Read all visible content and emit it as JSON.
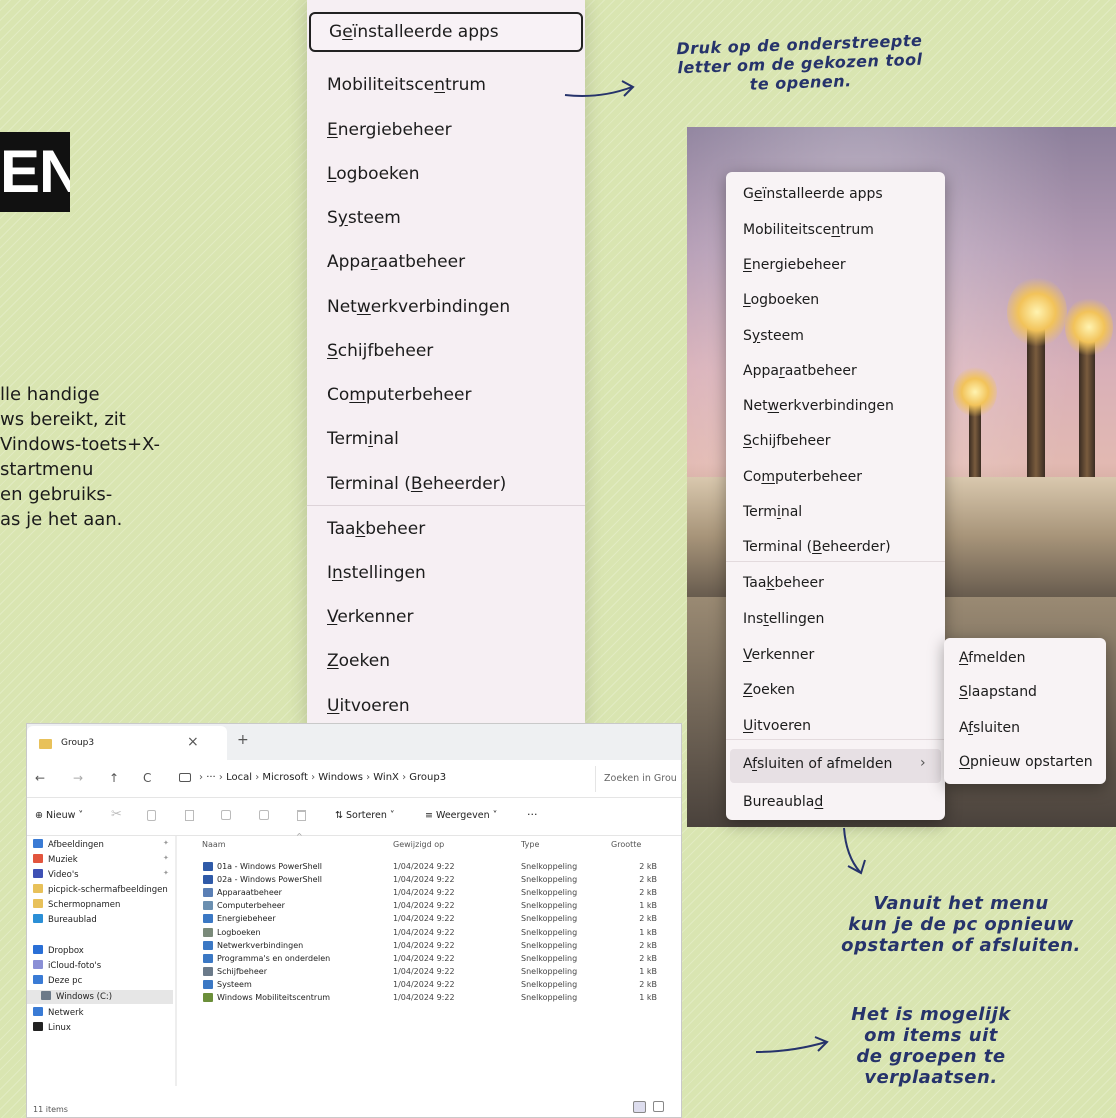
{
  "heading": {
    "letters": "EN"
  },
  "intro": {
    "lines": [
      "lle handige",
      "ws bereikt, zit",
      "Vindows-toets+X-",
      "startmenu",
      "en gebruiks-",
      "as je het aan."
    ]
  },
  "big_menu": {
    "items": [
      {
        "pre": "G",
        "ul": "e",
        "post": "ïnstalleerde apps"
      },
      {
        "pre": "Mobiliteitsce",
        "ul": "n",
        "post": "trum"
      },
      {
        "pre": "",
        "ul": "E",
        "post": "nergiebeheer"
      },
      {
        "pre": "",
        "ul": "L",
        "post": "ogboeken"
      },
      {
        "pre": "S",
        "ul": "y",
        "post": "steem"
      },
      {
        "pre": "Appa",
        "ul": "r",
        "post": "aatbeheer"
      },
      {
        "pre": "Net",
        "ul": "w",
        "post": "erkverbindingen"
      },
      {
        "pre": "",
        "ul": "S",
        "post": "chijfbeheer"
      },
      {
        "pre": "Co",
        "ul": "m",
        "post": "puterbeheer"
      },
      {
        "pre": "Term",
        "ul": "i",
        "post": "nal"
      },
      {
        "pre": "Terminal (",
        "ul": "B",
        "post": "eheerder)"
      },
      {
        "pre": "Taa",
        "ul": "k",
        "post": "beheer"
      },
      {
        "pre": "I",
        "ul": "n",
        "post": "stellingen"
      },
      {
        "pre": "",
        "ul": "V",
        "post": "erkenner"
      },
      {
        "pre": "",
        "ul": "Z",
        "post": "oeken"
      },
      {
        "pre": "",
        "ul": "U",
        "post": "itvoeren"
      }
    ]
  },
  "small_menu": {
    "items": [
      {
        "pre": "G",
        "ul": "e",
        "post": "ïnstalleerde apps"
      },
      {
        "pre": "Mobiliteitsce",
        "ul": "n",
        "post": "trum"
      },
      {
        "pre": "",
        "ul": "E",
        "post": "nergiebeheer"
      },
      {
        "pre": "",
        "ul": "L",
        "post": "ogboeken"
      },
      {
        "pre": "S",
        "ul": "y",
        "post": "steem"
      },
      {
        "pre": "Appa",
        "ul": "r",
        "post": "aatbeheer"
      },
      {
        "pre": "Net",
        "ul": "w",
        "post": "erkverbindingen"
      },
      {
        "pre": "",
        "ul": "S",
        "post": "chijfbeheer"
      },
      {
        "pre": "Co",
        "ul": "m",
        "post": "puterbeheer"
      },
      {
        "pre": "Term",
        "ul": "i",
        "post": "nal"
      },
      {
        "pre": "Terminal (",
        "ul": "B",
        "post": "eheerder)"
      },
      {
        "pre": "Taa",
        "ul": "k",
        "post": "beheer"
      },
      {
        "pre": "Ins",
        "ul": "t",
        "post": "ellingen"
      },
      {
        "pre": "",
        "ul": "V",
        "post": "erkenner"
      },
      {
        "pre": "",
        "ul": "Z",
        "post": "oeken"
      },
      {
        "pre": "",
        "ul": "U",
        "post": "itvoeren"
      },
      {
        "pre": "A",
        "ul": "f",
        "post": "sluiten of afmelden"
      },
      {
        "pre": "Bureaubla",
        "ul": "d",
        "post": ""
      }
    ],
    "chevron": "›"
  },
  "submenu": {
    "items": [
      {
        "pre": "",
        "ul": "A",
        "post": "fmelden"
      },
      {
        "pre": "",
        "ul": "S",
        "post": "laapstand"
      },
      {
        "pre": "A",
        "ul": "f",
        "post": "sluiten"
      },
      {
        "pre": "",
        "ul": "O",
        "post": "pnieuw opstarten"
      }
    ]
  },
  "notes": {
    "top": [
      "Druk op de onderstreepte",
      "letter om de gekozen tool",
      "te openen."
    ],
    "middle": [
      "Vanuit het menu",
      "kun je de pc opnieuw",
      "opstarten of afsluiten."
    ],
    "bottom": [
      "Het is mogelijk",
      "om items uit",
      "de groepen te",
      "verplaatsen."
    ]
  },
  "explorer": {
    "tab_title": "Group3",
    "tab_close": "×",
    "tab_add": "+",
    "nav": {
      "back": "←",
      "forward": "→",
      "up": "↑",
      "refresh": "C"
    },
    "breadcrumb": [
      "Local",
      "Microsoft",
      "Windows",
      "WinX",
      "Group3"
    ],
    "breadcrumb_more": "···",
    "search_placeholder": "Zoeken in Grou",
    "toolbar": {
      "new_label": "Nieuw",
      "sort_label": "Sorteren",
      "view_label": "Weergeven",
      "more": "···"
    },
    "columns": [
      "Naam",
      "Gewijzigd op",
      "Type",
      "Grootte"
    ],
    "sidebar": [
      "Afbeeldingen",
      "Muziek",
      "Video's",
      "picpick-schermafbeeldingen",
      "Schermopnamen",
      "Bureaublad",
      "Dropbox",
      "iCloud-foto's",
      "Deze pc",
      "Windows (C:)",
      "Netwerk",
      "Linux"
    ],
    "sidebar_colors": [
      "#3a7bd5",
      "#e2553d",
      "#3f51b5",
      "#e8c15a",
      "#e8c15a",
      "#2b8fd6",
      "#2a6fd6",
      "#8a8fd6",
      "#3a7bd5",
      "#6c7a89",
      "#3a7bd5",
      "#222222"
    ],
    "rows": [
      {
        "name": "01a - Windows PowerShell",
        "date": "1/04/2024 9:22",
        "type": "Snelkoppeling",
        "size": "2 kB",
        "color": "#2f5aa8"
      },
      {
        "name": "02a - Windows PowerShell",
        "date": "1/04/2024 9:22",
        "type": "Snelkoppeling",
        "size": "2 kB",
        "color": "#2f5aa8"
      },
      {
        "name": "Apparaatbeheer",
        "date": "1/04/2024 9:22",
        "type": "Snelkoppeling",
        "size": "2 kB",
        "color": "#5a7fb5"
      },
      {
        "name": "Computerbeheer",
        "date": "1/04/2024 9:22",
        "type": "Snelkoppeling",
        "size": "1 kB",
        "color": "#6b8fb0"
      },
      {
        "name": "Energiebeheer",
        "date": "1/04/2024 9:22",
        "type": "Snelkoppeling",
        "size": "2 kB",
        "color": "#3b78c4"
      },
      {
        "name": "Logboeken",
        "date": "1/04/2024 9:22",
        "type": "Snelkoppeling",
        "size": "1 kB",
        "color": "#7a8a7a"
      },
      {
        "name": "Netwerkverbindingen",
        "date": "1/04/2024 9:22",
        "type": "Snelkoppeling",
        "size": "2 kB",
        "color": "#3b78c4"
      },
      {
        "name": "Programma's en onderdelen",
        "date": "1/04/2024 9:22",
        "type": "Snelkoppeling",
        "size": "2 kB",
        "color": "#3b78c4"
      },
      {
        "name": "Schijfbeheer",
        "date": "1/04/2024 9:22",
        "type": "Snelkoppeling",
        "size": "1 kB",
        "color": "#6b7a8a"
      },
      {
        "name": "Systeem",
        "date": "1/04/2024 9:22",
        "type": "Snelkoppeling",
        "size": "2 kB",
        "color": "#3b78c4"
      },
      {
        "name": "Windows Mobiliteitscentrum",
        "date": "1/04/2024 9:22",
        "type": "Snelkoppeling",
        "size": "1 kB",
        "color": "#6b8f3a"
      }
    ],
    "status": "11 items"
  }
}
